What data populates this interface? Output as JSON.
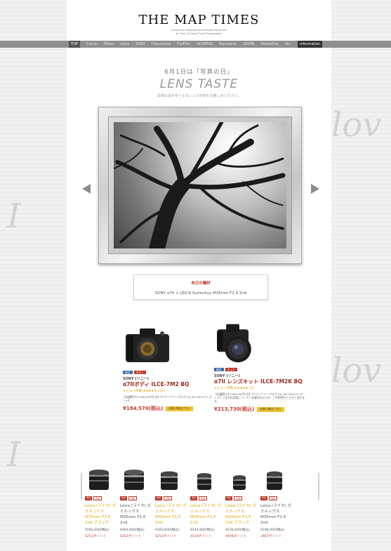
{
  "header": {
    "logo": "THE MAP TIMES",
    "logo_sub1": "Created by MapCamera All Rights Reserved.",
    "logo_sub2": "At Time, All News From Photography"
  },
  "nav": {
    "items": [
      "TOP",
      "Canon",
      "Nikon",
      "Leica",
      "SONY",
      "Hasselblad",
      "FujiFilm",
      "OLYMPUS",
      "Panasonic",
      "SIGMA",
      "PhaseOne",
      "etc.",
      "information"
    ]
  },
  "hero": {
    "date_line": "6月1日は「写真の日」",
    "title": "LENS TASTE",
    "subtitle": "写真の決め手となるレンズの味をお楽しみください。"
  },
  "featured": {
    "title": "本日の機材",
    "text": "SONY α7II + LEICA Summilux M35mm F1.4 2nd"
  },
  "products": [
    {
      "tags": [
        "新品",
        "ボディ"
      ],
      "brand": "SONY (ソニー)",
      "name": "α7IIボディ ILCE-7M2 BQ",
      "rating_prefix": "レビュー件数",
      "rating_stars": "★★★★★",
      "rating_count": "(13)",
      "note": "【店舗受付もOLBO00円引き】【ソナーナインプログラム NP-FW50プレゼント】",
      "price": "¥184,570(税込)",
      "buy_label": "お買い物はこちら"
    },
    {
      "tags": [
        "新品",
        "キット"
      ],
      "brand": "SONY (ソニー)",
      "name": "α7II レンズキット ILCE-7M2K BQ",
      "rating_prefix": "レビュー件数",
      "rating_stars": "★★★★★",
      "rating_count": "(3)",
      "note": "【店舗受付もOLBO00円引き】【ソナーナインプログラム NP-FW50プレゼント】ご注文の前提にメーカー在庫切れのため、ご予約受付とさせて頂きます。",
      "price": "¥213,730(税込)",
      "buy_label": "お買い物はこちら"
    }
  ],
  "lenses": [
    {
      "tags": [
        "中古",
        "良品"
      ],
      "name": "Leica (ライカ) ズミルックス M35mm F1.4 2nd ブラック",
      "price": "¥283,600(税込)",
      "points": "5252ポイント",
      "dark": false
    },
    {
      "tags": [
        "中古",
        "良品"
      ],
      "name": "Leica (ライカ) ズミルックス M35mm F1.4 2nd",
      "price": "¥283,600(税込)",
      "points": "5252ポイント",
      "dark": true
    },
    {
      "tags": [
        "中古",
        "良品"
      ],
      "name": "Leica (ライカ) ズミルックス M35mm F1.4 2nd",
      "price": "¥283,600(税込)",
      "points": "5252ポイント",
      "dark": false
    },
    {
      "tags": [
        "中古",
        "良品"
      ],
      "name": "Leica (ライカ) ズミルックス M35mm F1.4 2nd",
      "price": "¥244,800(税込)",
      "points": "4534ポイント",
      "dark": false
    },
    {
      "tags": [
        "中古",
        "良品"
      ],
      "name": "Leica (ライカ) ズミルックス M35mm F1.4 2nd ブラック",
      "price": "¥238,000(税込)",
      "points": "4408ポイント",
      "dark": false
    },
    {
      "tags": [
        "中古",
        "美品"
      ],
      "name": "Leica (ライカ) ズミルックス M35mm F1.4 2nd",
      "price": "¥198,000(税込)",
      "points": "3667ポイント",
      "dark": true
    }
  ]
}
